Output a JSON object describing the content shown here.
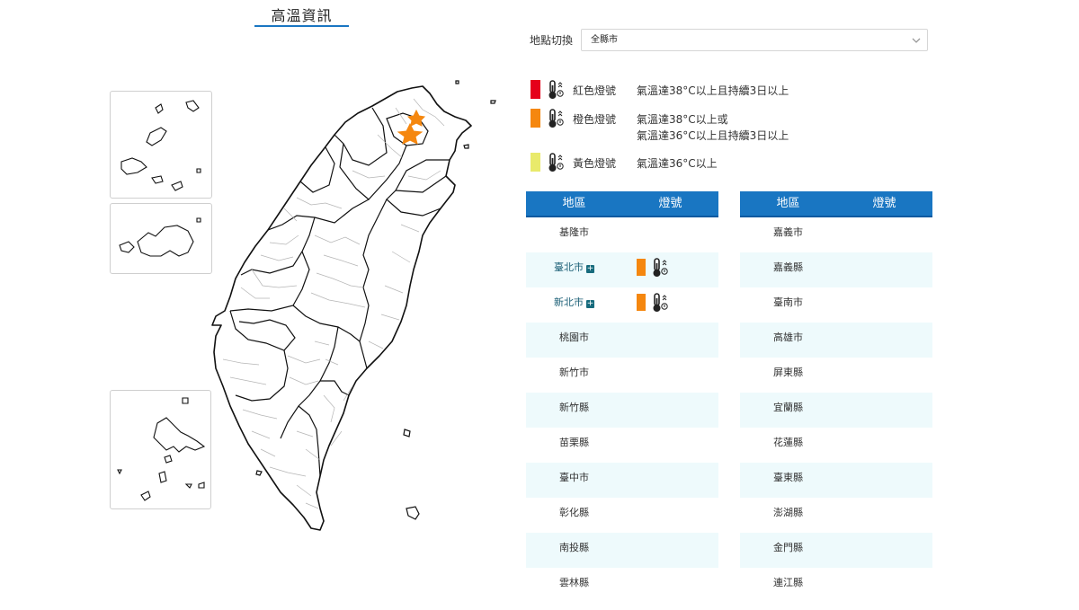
{
  "title": "高溫資訊",
  "location": {
    "label": "地點切換",
    "selected": "全縣市"
  },
  "legend": [
    {
      "name": "紅色燈號",
      "color": "#e5001a",
      "icon": "thermometer-icon",
      "desc": [
        "氣溫達38°C以上且持續3日以上"
      ]
    },
    {
      "name": "橙色燈號",
      "color": "#f5870f",
      "icon": "thermometer-icon",
      "desc": [
        "氣溫達38°C以上或",
        "氣溫達36°C以上且持續3日以上"
      ]
    },
    {
      "name": "黃色燈號",
      "color": "#e9ea6b",
      "icon": "thermometer-icon",
      "desc": [
        "氣溫達36°C以上"
      ]
    }
  ],
  "table_headers": {
    "region": "地區",
    "signal": "燈號"
  },
  "left_rows": [
    {
      "region": "基隆市",
      "signal": ""
    },
    {
      "region": "臺北市",
      "signal": "orange",
      "expand": true
    },
    {
      "region": "新北市",
      "signal": "orange",
      "expand": true
    },
    {
      "region": "桃園市",
      "signal": ""
    },
    {
      "region": "新竹市",
      "signal": ""
    },
    {
      "region": "新竹縣",
      "signal": ""
    },
    {
      "region": "苗栗縣",
      "signal": ""
    },
    {
      "region": "臺中市",
      "signal": ""
    },
    {
      "region": "彰化縣",
      "signal": ""
    },
    {
      "region": "南投縣",
      "signal": ""
    },
    {
      "region": "雲林縣",
      "signal": ""
    }
  ],
  "right_rows": [
    {
      "region": "嘉義市",
      "signal": ""
    },
    {
      "region": "嘉義縣",
      "signal": ""
    },
    {
      "region": "臺南市",
      "signal": ""
    },
    {
      "region": "高雄市",
      "signal": ""
    },
    {
      "region": "屏東縣",
      "signal": ""
    },
    {
      "region": "宜蘭縣",
      "signal": ""
    },
    {
      "region": "花蓮縣",
      "signal": ""
    },
    {
      "region": "臺東縣",
      "signal": ""
    },
    {
      "region": "澎湖縣",
      "signal": ""
    },
    {
      "region": "金門縣",
      "signal": ""
    },
    {
      "region": "連江縣",
      "signal": ""
    }
  ],
  "map_markers": [
    {
      "region": "臺北市",
      "signal": "orange",
      "color": "#f5870f"
    },
    {
      "region": "新北市",
      "signal": "orange",
      "color": "#f5870f"
    }
  ]
}
